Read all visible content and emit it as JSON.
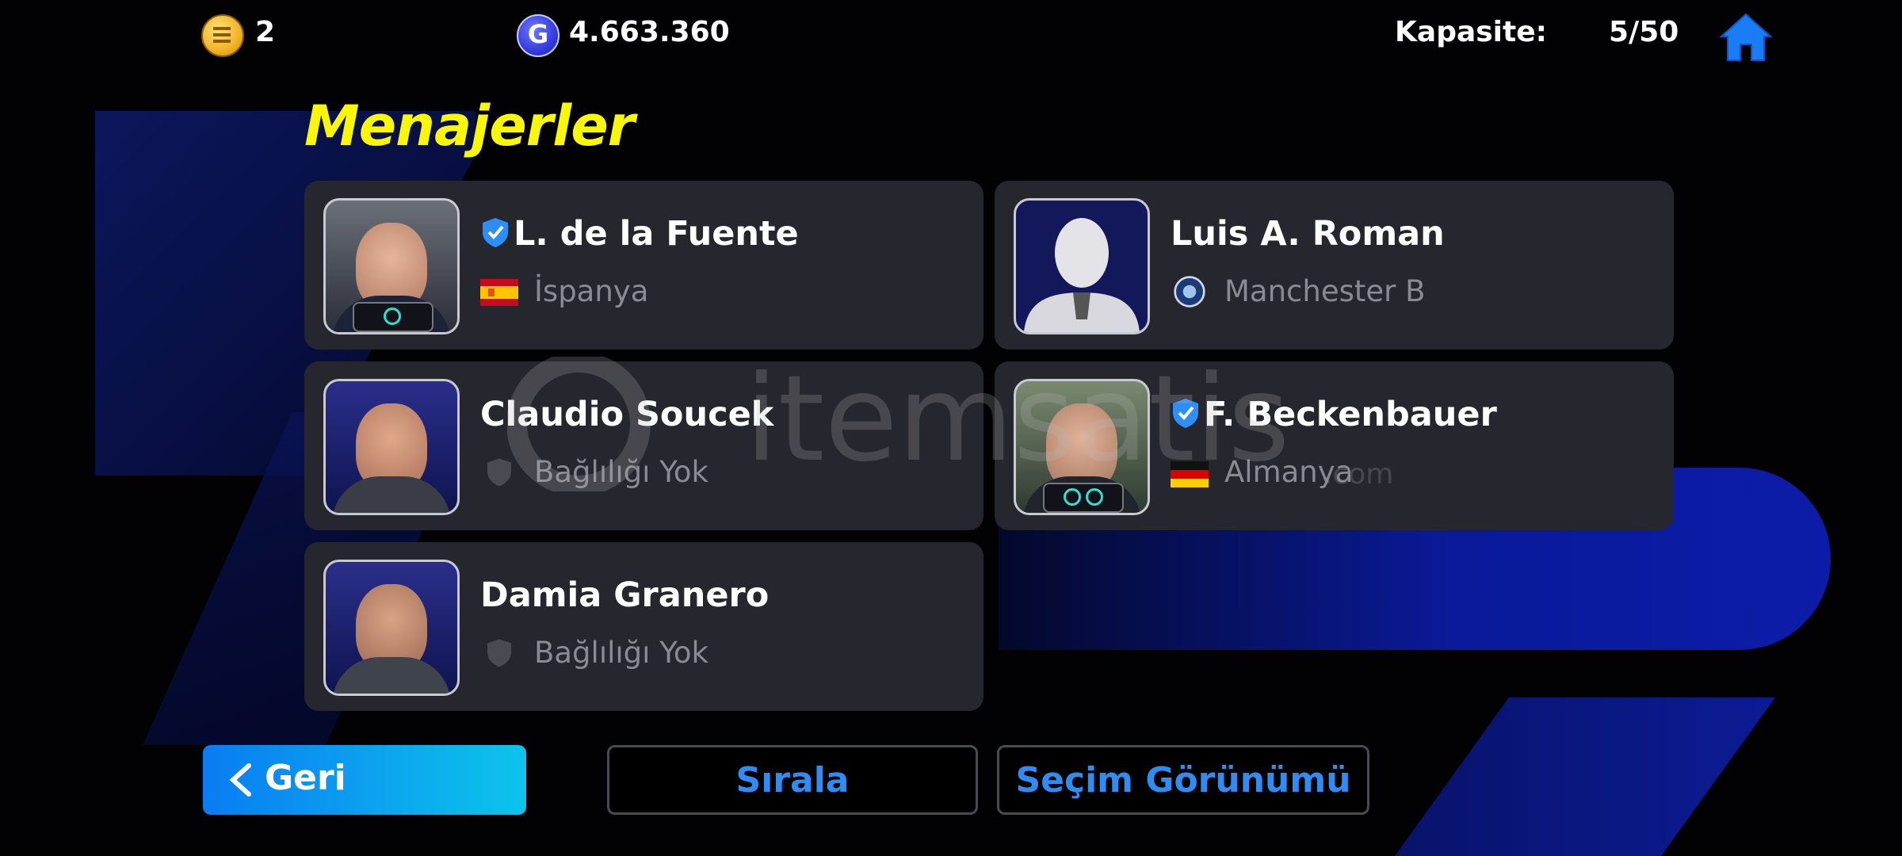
{
  "topbar": {
    "coins": "2",
    "gp_symbol": "G",
    "gp": "4.663.360",
    "capacity_label": "Kapasite:",
    "capacity_value": "5/50"
  },
  "title": "Menajerler",
  "managers": [
    {
      "name": "L. de la Fuente",
      "affiliation": "İspanya",
      "verified": true,
      "affiliation_icon": "spain-flag-icon"
    },
    {
      "name": "Luis A. Roman",
      "affiliation": "Manchester B",
      "verified": false,
      "affiliation_icon": "club-crest-icon"
    },
    {
      "name": "Claudio Soucek",
      "affiliation": "Bağlılığı Yok",
      "verified": false,
      "affiliation_icon": "shield-icon"
    },
    {
      "name": "F. Beckenbauer",
      "affiliation": "Almanya",
      "verified": true,
      "affiliation_icon": "germany-flag-icon"
    },
    {
      "name": "Damia Granero",
      "affiliation": "Bağlılığı Yok",
      "verified": false,
      "affiliation_icon": "shield-icon"
    }
  ],
  "buttons": {
    "back": "Geri",
    "sort": "Sırala",
    "selection_view": "Seçim Görünümü"
  },
  "watermark": {
    "text": "itemsatis",
    "sub": ".com"
  },
  "colors": {
    "title": "#f8f70a",
    "accent": "#2e8df5",
    "card": "#26262e"
  }
}
